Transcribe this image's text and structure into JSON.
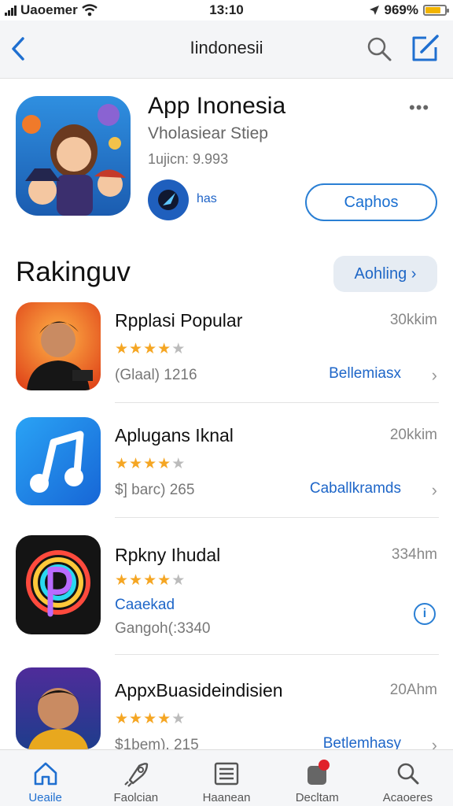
{
  "status_bar": {
    "carrier": "Uaoemer",
    "time": "13:10",
    "battery": "969%",
    "battery_level_pct": 80
  },
  "nav": {
    "title": "Iindonesii"
  },
  "featured": {
    "title": "App Inonesia",
    "subtitle": "Vholasiear Stiep",
    "meta": "1ujicn: 9.993",
    "badge_label": "has",
    "get_label": "Caphos",
    "more": "•••"
  },
  "section": {
    "title": "Rakinguv",
    "button_label": "Aohling ›"
  },
  "apps": [
    {
      "name": "Rpplasi Popular",
      "distance": "30kkim",
      "rating": 4,
      "info": "(Glaal) 1216",
      "action": "Bellemiasx"
    },
    {
      "name": "Aplugans Iknal",
      "distance": "20kkim",
      "rating": 4,
      "info": "$] barc) 265",
      "action": "Caballkramds"
    },
    {
      "name": "Rpkny Ihudal",
      "distance": "334hm",
      "rating": 4,
      "category": "Caaekad",
      "info": "Gangoh(:3340"
    },
    {
      "name": "AppxBuasideindisien",
      "distance": "20Ahm",
      "rating": 4,
      "info": "$1bem), 215",
      "action": "Betlemhasy"
    }
  ],
  "tabs": [
    {
      "label": "Ueaile",
      "icon": "home-icon"
    },
    {
      "label": "Faolcian",
      "icon": "rocket-icon"
    },
    {
      "label": "Haanean",
      "icon": "list-icon"
    },
    {
      "label": "Decltam",
      "icon": "updates-icon"
    },
    {
      "label": "Acaoeres",
      "icon": "search-icon"
    }
  ],
  "colors": {
    "accent": "#1f6fd0",
    "star": "#f5a623",
    "badge_red": "#e0202a"
  }
}
